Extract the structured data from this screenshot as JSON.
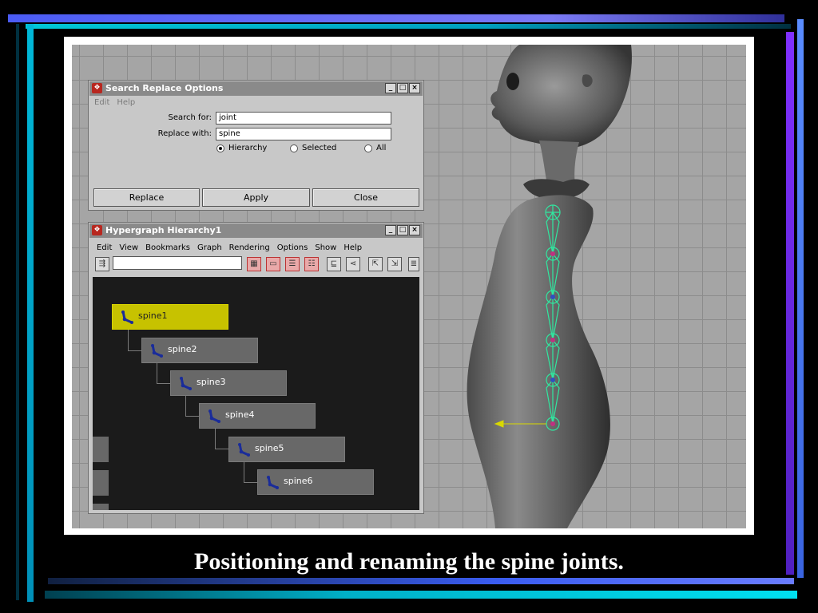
{
  "slide": {
    "caption": "Positioning and renaming the spine joints.",
    "accent_colors": [
      "#00d2e6",
      "#4c6cff",
      "#7b2cff"
    ]
  },
  "search_replace": {
    "title": "Search Replace Options",
    "menu": [
      "Edit",
      "Help"
    ],
    "search_label": "Search for:",
    "search_value": "joint",
    "replace_label": "Replace with:",
    "replace_value": "spine",
    "scope_options": [
      {
        "label": "Hierarchy",
        "selected": true
      },
      {
        "label": "Selected",
        "selected": false
      },
      {
        "label": "All",
        "selected": false
      }
    ],
    "buttons": [
      "Replace",
      "Apply",
      "Close"
    ]
  },
  "hypergraph": {
    "title": "Hypergraph Hierarchy1",
    "menu": [
      "Edit",
      "View",
      "Bookmarks",
      "Graph",
      "Rendering",
      "Options",
      "Show",
      "Help"
    ],
    "search_value": "",
    "nodes": [
      {
        "label": "spine1",
        "selected": true
      },
      {
        "label": "spine2",
        "selected": false
      },
      {
        "label": "spine3",
        "selected": false
      },
      {
        "label": "spine4",
        "selected": false
      },
      {
        "label": "spine5",
        "selected": false
      },
      {
        "label": "spine6",
        "selected": false
      }
    ],
    "node_selected_color": "#c7c200"
  },
  "window_controls": {
    "minimize": "_",
    "maximize": "□",
    "close": "×"
  },
  "icons": {
    "app": "maya-app-icon",
    "joint": "joint-icon",
    "tools": [
      "hierarchy-mode-icon",
      "frame-all-icon",
      "frame-selection-icon",
      "frame-branch-icon",
      "layout-icon",
      "rebuild-icon",
      "input-connections-icon",
      "output-connections-icon",
      "scene-hierarchy-icon"
    ]
  }
}
